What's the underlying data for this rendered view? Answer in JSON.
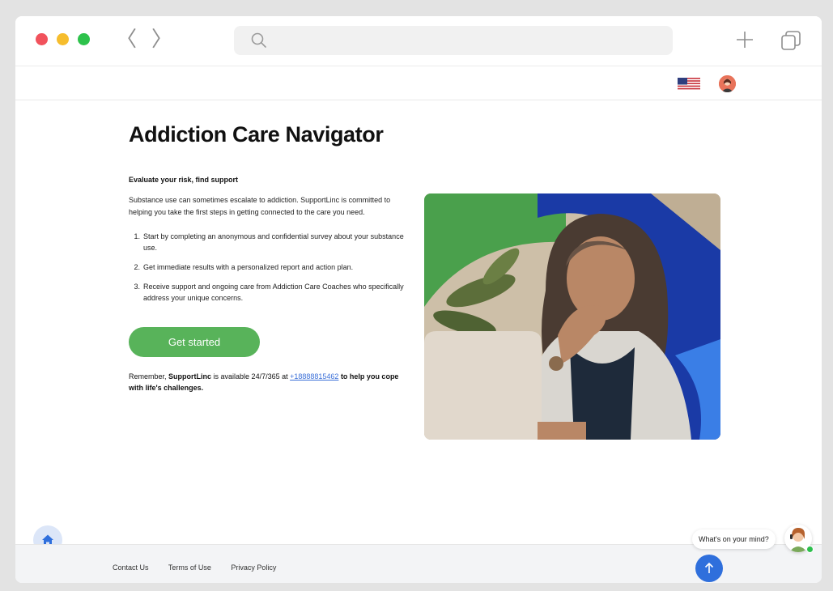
{
  "browser": {
    "back_glyph": "〈",
    "forward_glyph": "〉",
    "icons": [
      "search-icon",
      "plus-icon",
      "tabs-icon"
    ]
  },
  "header": {
    "language_icon": "us-flag-icon",
    "profile_icon": "avatar"
  },
  "main": {
    "title": "Addiction Care Navigator",
    "subtitle": "Evaluate your risk, find support",
    "intro": "Substance use can sometimes escalate to addiction. SupportLinc is committed to helping you take the first steps in getting connected to the care you need.",
    "steps": [
      {
        "num": "1.",
        "text": "Start by completing an anonymous and confidential survey about your substance use."
      },
      {
        "num": "2.",
        "text": "Get immediate results with a personalized report and action plan."
      },
      {
        "num": "3.",
        "text": "Receive support and ongoing care from Addiction Care Coaches who specifically address your unique concerns."
      }
    ],
    "cta_label": "Get started",
    "reminder": {
      "prefix": "Remember, ",
      "brand": "SupportLinc",
      "middle": " is available 24/7/365 at ",
      "phone": "+18888815462",
      "suffix": " to help you cope with life's challenges."
    }
  },
  "footer": {
    "links": [
      "Contact Us",
      "Terms of Use",
      "Privacy Policy"
    ]
  },
  "chat": {
    "prompt": "What's on your mind?"
  },
  "colors": {
    "accent_green": "#58b35a",
    "accent_blue": "#2f6fdc",
    "link_blue": "#3a6fd8"
  }
}
